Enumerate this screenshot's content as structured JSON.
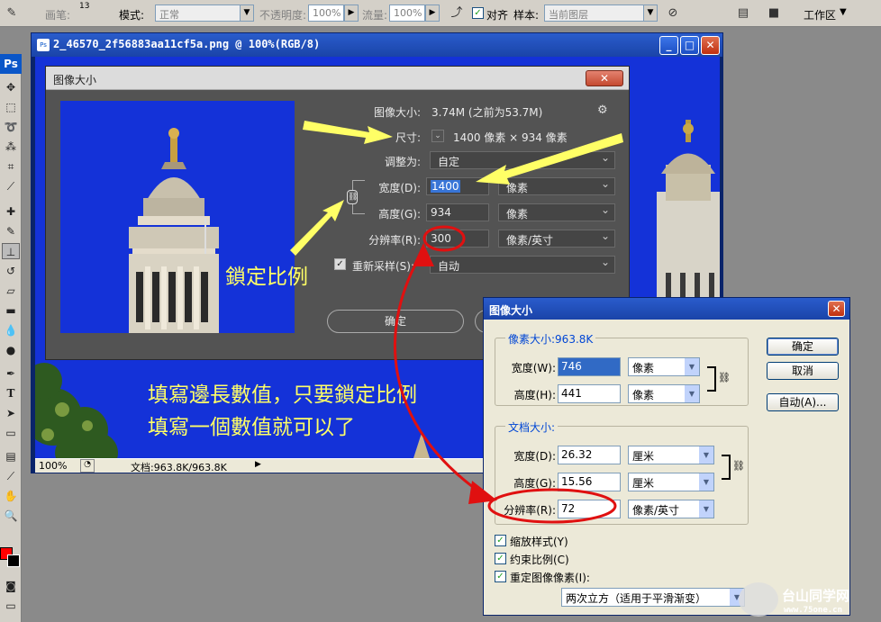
{
  "toolbar": {
    "brush_label": "画笔:",
    "brush_size": "13",
    "mode_label": "模式:",
    "mode_value": "正常",
    "opacity_label": "不透明度:",
    "opacity_value": "100%",
    "flow_label": "流量:",
    "flow_value": "100%",
    "aligned_label": "对齐",
    "sample_label": "样本:",
    "sample_value": "当前图层",
    "workspace_label": "工作区"
  },
  "app_logo": "Ps",
  "document": {
    "title": "2_46570_2f56883aa11cf5a.png @ 100%(RGB/8)",
    "zoom": "100%",
    "status": "文档:963.8K/963.8K"
  },
  "dialog_cs": {
    "title": "图像大小",
    "image_size_label": "图像大小:",
    "image_size_value": "3.74M (之前为53.7M)",
    "dimensions_label": "尺寸:",
    "dimensions_value": "1400 像素 × 934 像素",
    "fit_to_label": "调整为:",
    "fit_to_value": "自定",
    "width_label": "宽度(D):",
    "width_value": "1400",
    "width_unit": "像素",
    "height_label": "高度(G):",
    "height_value": "934",
    "height_unit": "像素",
    "resolution_label": "分辨率(R):",
    "resolution_value": "300",
    "resolution_unit": "像素/英寸",
    "resample_label": "重新采样(S):",
    "resample_value": "自动",
    "ok_label": "确定"
  },
  "dialog_classic": {
    "title": "图像大小",
    "pixel_group": "像素大小:963.8K",
    "width_label": "宽度(W):",
    "width_value": "746",
    "width_unit": "像素",
    "height_label": "高度(H):",
    "height_value": "441",
    "height_unit": "像素",
    "doc_group": "文档大小:",
    "doc_width_label": "宽度(D):",
    "doc_width_value": "26.32",
    "doc_width_unit": "厘米",
    "doc_height_label": "高度(G):",
    "doc_height_value": "15.56",
    "doc_height_unit": "厘米",
    "resolution_label": "分辨率(R):",
    "resolution_value": "72",
    "resolution_unit": "像素/英寸",
    "scale_styles_label": "缩放样式(Y)",
    "constrain_label": "约束比例(C)",
    "resample_label": "重定图像像素(I):",
    "resample_value": "两次立方（适用于平滑渐变）",
    "ok_label": "确定",
    "cancel_label": "取消",
    "auto_label": "自动(A)..."
  },
  "annotations": {
    "lock_ratio": "鎖定比例",
    "line1": "填寫邊長數值，只要鎖定比例",
    "line2": "填寫一個數值就可以了"
  },
  "watermark": {
    "site_cn": "台山同学网",
    "site_url": "www.75one.cn"
  },
  "colors": {
    "sky": "#1432d8",
    "annotation_yellow": "#ffff66",
    "arrow_red": "#e01010",
    "foreground_swatch": "#ff0000"
  }
}
